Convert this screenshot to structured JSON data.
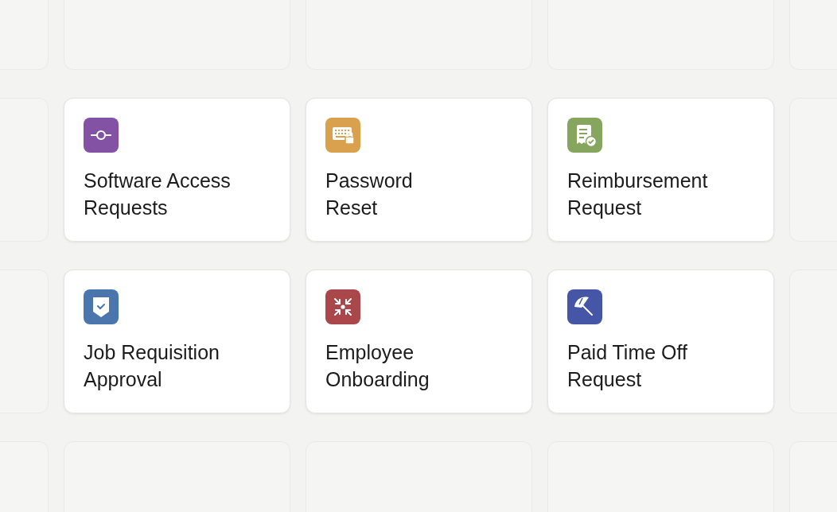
{
  "cards": [
    {
      "title": "Software Access\nRequests",
      "color": "#8452a4"
    },
    {
      "title": "Password\nReset",
      "color": "#d9a04e"
    },
    {
      "title": "Reimbursement\nRequest",
      "color": "#86a55e"
    },
    {
      "title": "Job Requisition\nApproval",
      "color": "#4a75ad"
    },
    {
      "title": "Employee\nOnboarding",
      "color": "#a9474a"
    },
    {
      "title": "Paid Time Off\nRequest",
      "color": "#4656a6"
    }
  ]
}
